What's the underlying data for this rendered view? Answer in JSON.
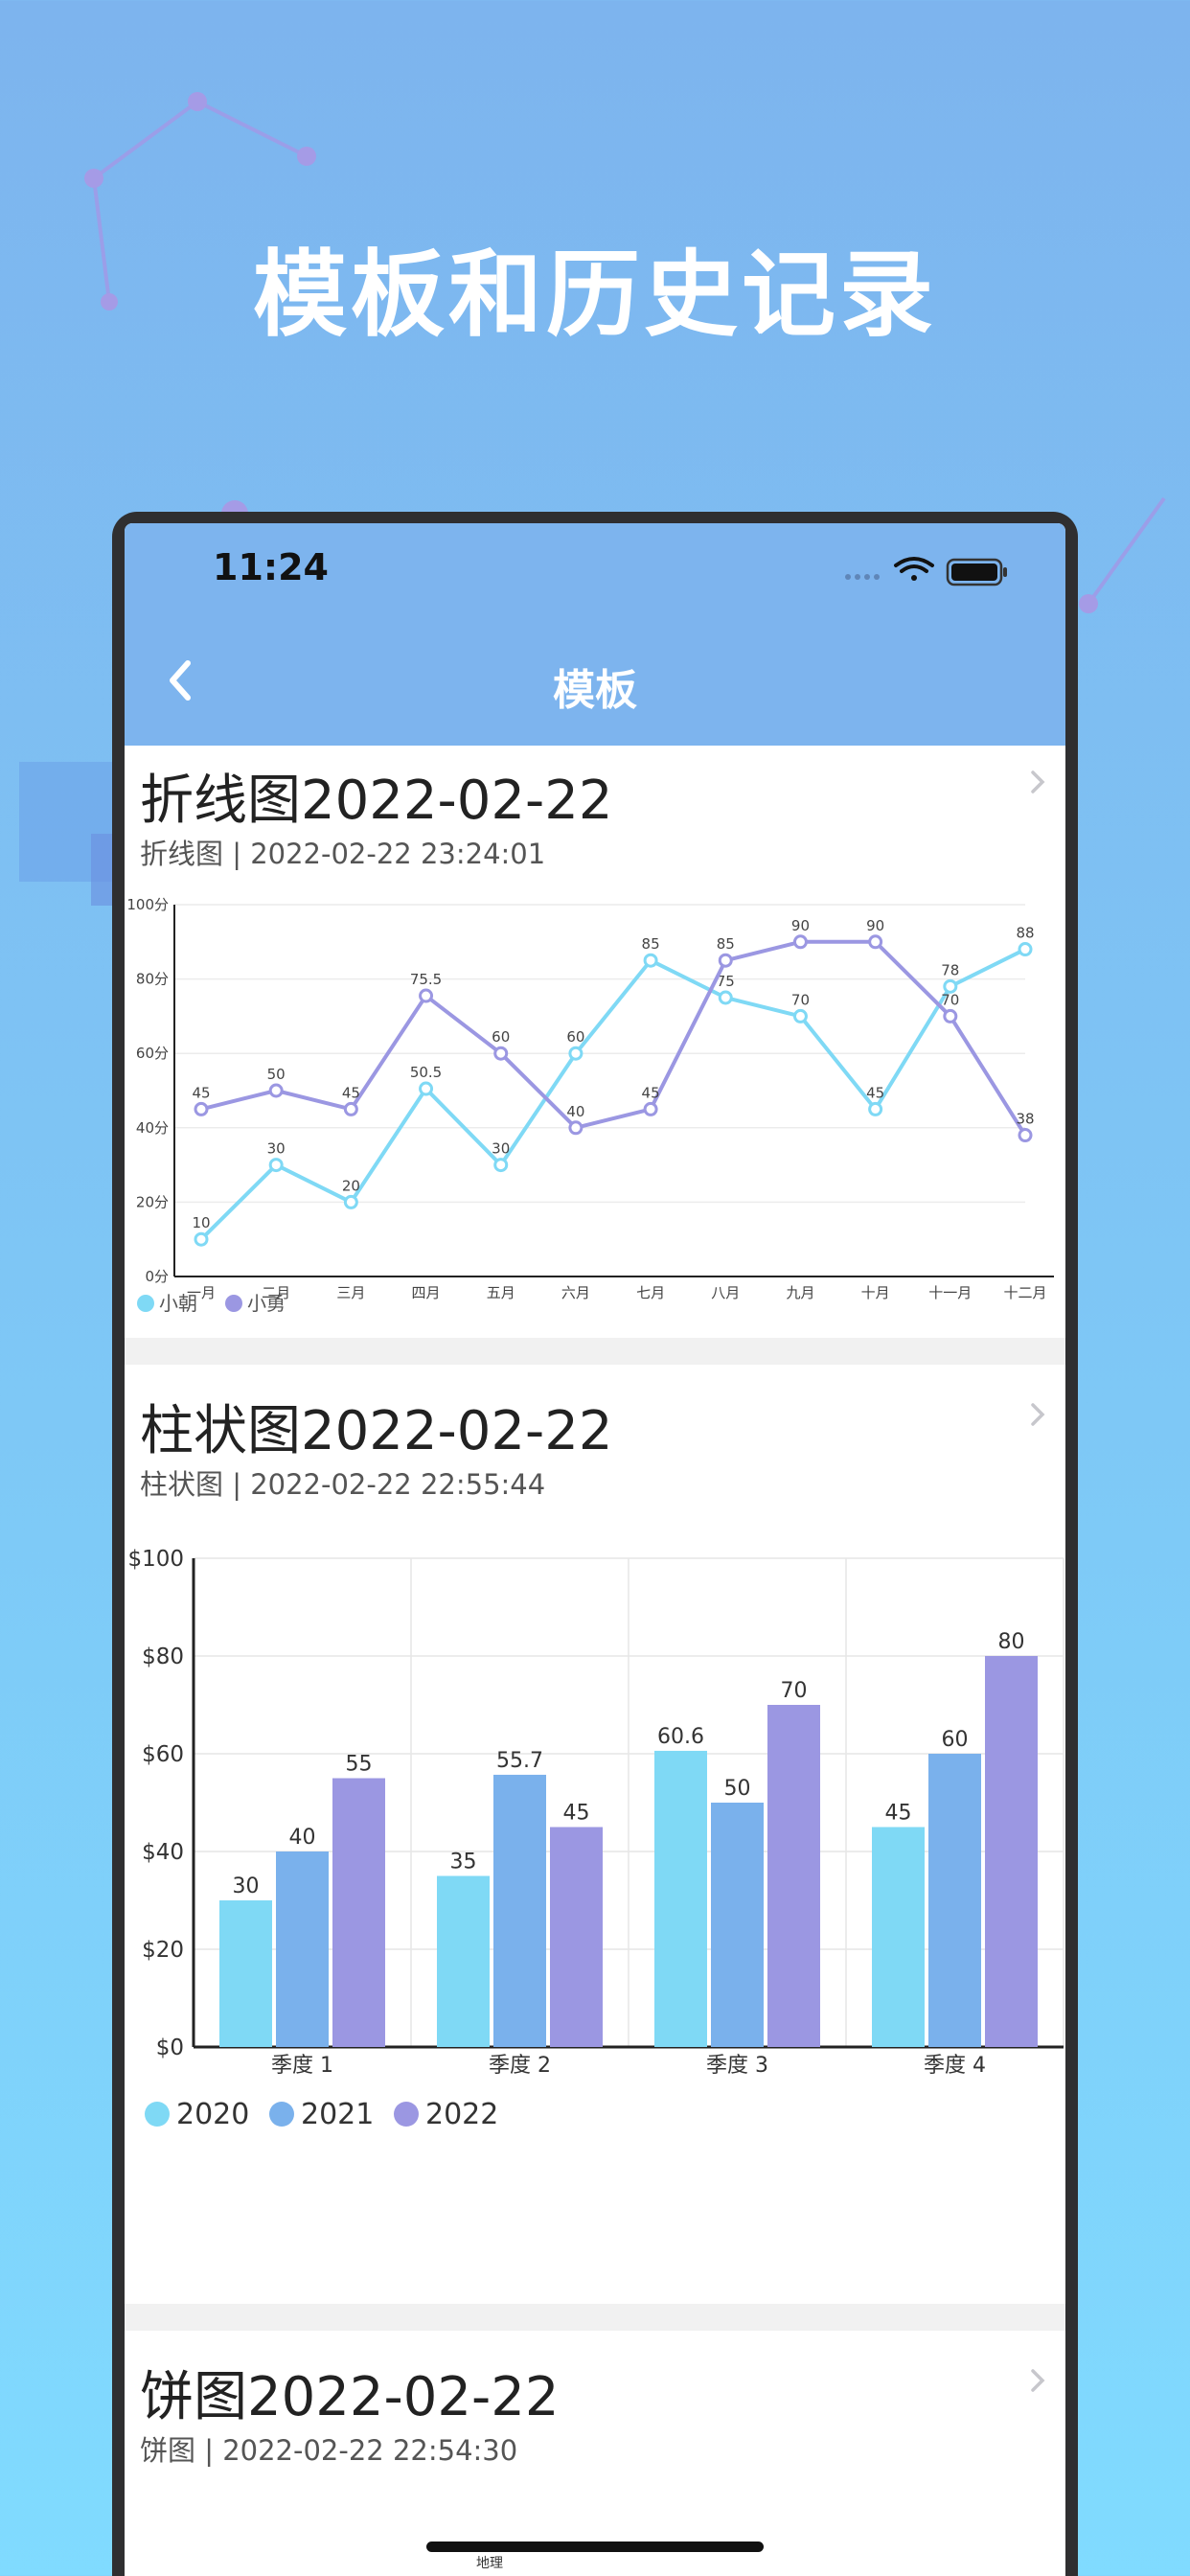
{
  "headline": "模板和历史记录",
  "status_bar": {
    "time": "11:24"
  },
  "nav": {
    "title": "模板",
    "back_icon": "chevron-left-icon"
  },
  "cards": [
    {
      "title": "折线图2022-02-22",
      "subtitle": "折线图 | 2022-02-22 23:24:01",
      "chevron_icon": "chevron-right-icon"
    },
    {
      "title": "柱状图2022-02-22",
      "subtitle": "柱状图 | 2022-02-22 22:55:44",
      "chevron_icon": "chevron-right-icon"
    },
    {
      "title": "饼图2022-02-22",
      "subtitle": "饼图 | 2022-02-22 22:54:30",
      "chevron_icon": "chevron-right-icon"
    }
  ],
  "pie_partial_label": "地理",
  "colors": {
    "background": "#7db4ee",
    "nav": "#7db4ee",
    "series_a": "#7fd9f5",
    "series_b": "#9b97e2",
    "series_c": "#7ab1ec"
  },
  "chart_data": [
    {
      "type": "line",
      "categories": [
        "一月",
        "二月",
        "三月",
        "四月",
        "五月",
        "六月",
        "七月",
        "八月",
        "九月",
        "十月",
        "十一月",
        "十二月"
      ],
      "y_ticks": [
        "0分",
        "20分",
        "40分",
        "60分",
        "80分",
        "100分"
      ],
      "ylim": [
        0,
        100
      ],
      "series": [
        {
          "name": "小朝",
          "color": "#7fd9f5",
          "values": [
            10,
            30,
            20,
            50.5,
            30,
            60,
            85,
            75,
            70,
            45,
            78,
            88
          ]
        },
        {
          "name": "小勇",
          "color": "#9b97e2",
          "values": [
            45,
            50,
            45,
            75.5,
            60,
            40,
            45,
            85,
            90,
            90,
            70,
            38
          ]
        }
      ],
      "legend": "bottom-left",
      "grid": true
    },
    {
      "type": "bar",
      "categories": [
        "季度 1",
        "季度 2",
        "季度 3",
        "季度 4"
      ],
      "y_ticks": [
        "$0",
        "$20",
        "$40",
        "$60",
        "$80",
        "$100"
      ],
      "ylim": [
        0,
        100
      ],
      "series": [
        {
          "name": "2020",
          "color": "#7fd9f5",
          "values": [
            30,
            35,
            60.6,
            45
          ]
        },
        {
          "name": "2021",
          "color": "#7ab1ec",
          "values": [
            40,
            55.7,
            50,
            60
          ]
        },
        {
          "name": "2022",
          "color": "#9b97e2",
          "values": [
            55,
            45,
            70,
            80
          ]
        }
      ],
      "legend": "bottom-left",
      "grid": true
    }
  ]
}
